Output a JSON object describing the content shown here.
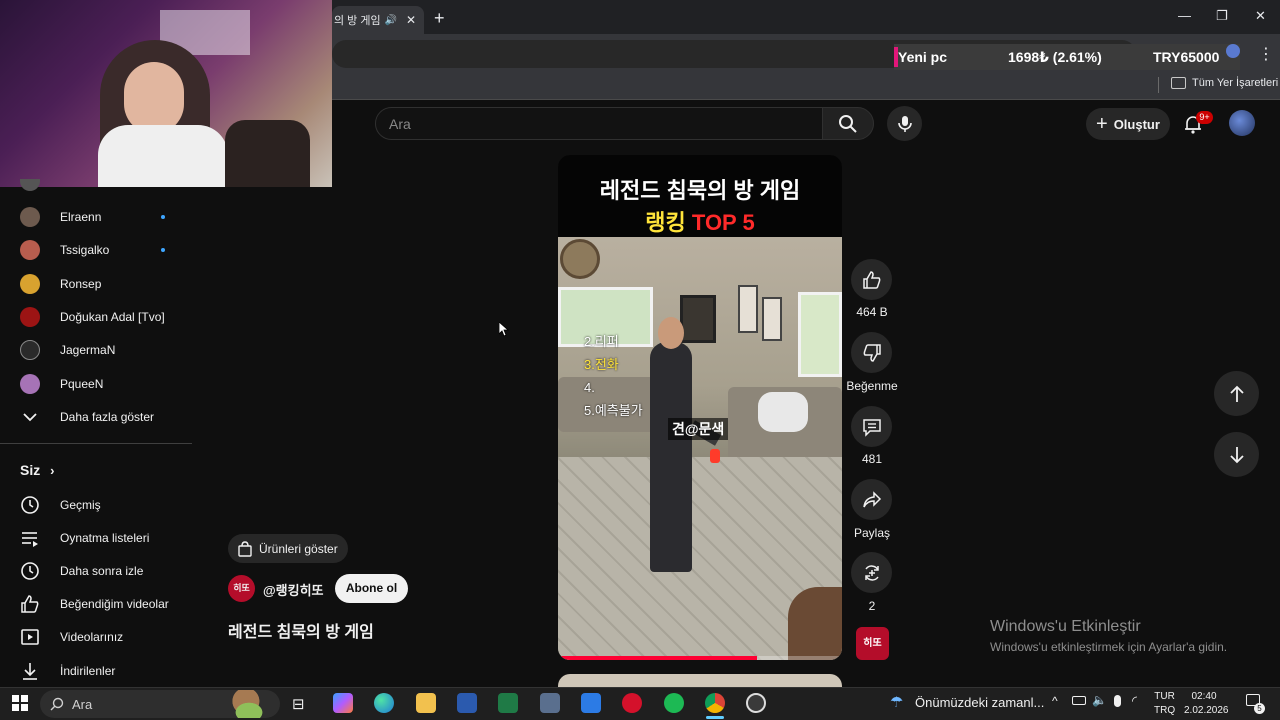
{
  "browser": {
    "tab_title": "의 방 게임",
    "new_tab": "+",
    "window_controls": {
      "minimize": "—",
      "maximize": "❐",
      "close": "✕"
    },
    "ticker": {
      "label": "Yeni pc",
      "value": "1698₺ (2.61%)",
      "goal": "TRY65000"
    },
    "bookmarks_folder": "Tüm Yer İşaretleri"
  },
  "header": {
    "search_placeholder": "Ara",
    "create_label": "Oluştur",
    "notification_badge": "9+"
  },
  "sidebar": {
    "subscriptions": [
      {
        "name": "Elraenn",
        "new": true,
        "color": "#6d5a4e"
      },
      {
        "name": "Tssigalko",
        "new": true,
        "color": "#b85d4e"
      },
      {
        "name": "Ronsep",
        "new": false,
        "color": "#d8a22f"
      },
      {
        "name": "Doğukan Adal [Tvo]",
        "new": false,
        "color": "#9c1414"
      },
      {
        "name": "JagermaN",
        "new": false,
        "color": "#2a2a2a"
      },
      {
        "name": "PqueeN",
        "new": false,
        "color": "#a673b6"
      }
    ],
    "more_label": "Daha fazla göster",
    "you_label": "Siz",
    "you_items": [
      {
        "label": "Geçmiş",
        "icon": "history-icon"
      },
      {
        "label": "Oynatma listeleri",
        "icon": "playlists-icon"
      },
      {
        "label": "Daha sonra izle",
        "icon": "watch-later-icon"
      },
      {
        "label": "Beğendiğim videolar",
        "icon": "liked-icon"
      },
      {
        "label": "Videolarınız",
        "icon": "your-videos-icon"
      },
      {
        "label": "İndirilenler",
        "icon": "downloads-icon"
      }
    ]
  },
  "short": {
    "title_line1": "레전드 침묵의 방 게임",
    "title_line2_yellow": "랭킹",
    "title_line2_red": "TOP 5",
    "ranking": [
      "2.리퍼",
      "3.전화",
      "4.",
      "5.예측불가"
    ],
    "caption": "견@문색",
    "progress": 0.7
  },
  "actions": {
    "likes": "464 B",
    "dislike_label": "Beğenme",
    "comments": "481",
    "share_label": "Paylaş",
    "remix_count": "2"
  },
  "overlay": {
    "products_label": "Ürünleri göster",
    "channel_logo": "히또",
    "channel_handle": "@랭킹히또",
    "subscribe_label": "Abone ol",
    "video_title": "레전드 침묵의 방 게임"
  },
  "watermark": {
    "title": "Windows'u Etkinleştir",
    "subtitle": "Windows'u etkinleştirmek için Ayarlar'a gidin."
  },
  "taskbar": {
    "search_placeholder": "Ara",
    "weather": "Önümüzdeki zamanl...",
    "lang1": "TUR",
    "lang2": "TRQ",
    "time": "02:40",
    "date": "2.02.2026",
    "notifications": "5"
  }
}
